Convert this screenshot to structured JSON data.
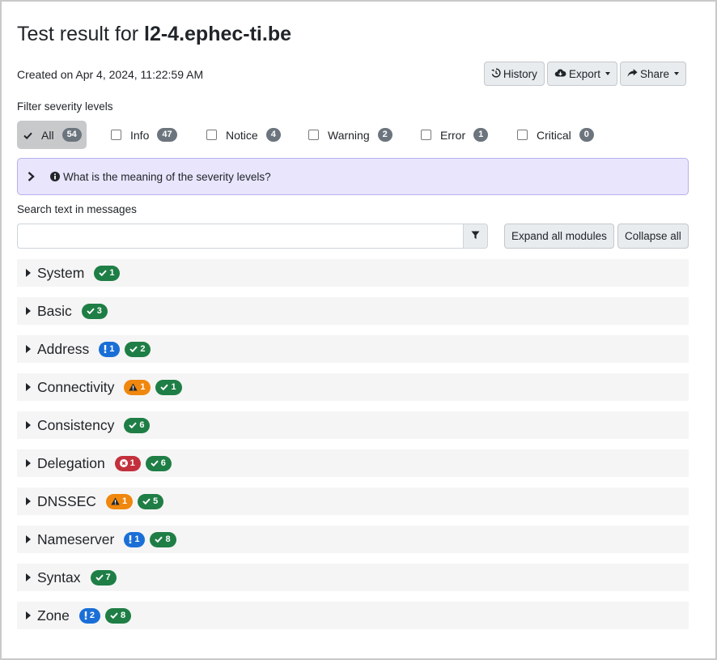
{
  "header": {
    "title_prefix": "Test result for ",
    "domain": "l2-4.ephec-ti.be",
    "created": "Created on Apr 4, 2024, 11:22:59 AM"
  },
  "toolbar": {
    "history_label": "History",
    "export_label": "Export",
    "share_label": "Share"
  },
  "filter": {
    "label": "Filter severity levels",
    "levels": [
      {
        "label": "All",
        "count": "54"
      },
      {
        "label": "Info",
        "count": "47"
      },
      {
        "label": "Notice",
        "count": "4"
      },
      {
        "label": "Warning",
        "count": "2"
      },
      {
        "label": "Error",
        "count": "1"
      },
      {
        "label": "Critical",
        "count": "0"
      }
    ]
  },
  "severity_help": {
    "label": "What is the meaning of the severity levels?"
  },
  "search": {
    "label": "Search text in messages",
    "value": "",
    "placeholder": "",
    "expand_label": "Expand all modules",
    "collapse_label": "Collapse all"
  },
  "colors": {
    "ok": "#1e7e45",
    "notice": "#1a6fd6",
    "warning": "#f0870e",
    "error": "#c3303c",
    "help_bg": "#e8e5fd"
  },
  "modules": [
    {
      "name": "System",
      "badges": [
        {
          "type": "ok",
          "count": "1"
        }
      ]
    },
    {
      "name": "Basic",
      "badges": [
        {
          "type": "ok",
          "count": "3"
        }
      ]
    },
    {
      "name": "Address",
      "badges": [
        {
          "type": "notice",
          "count": "1"
        },
        {
          "type": "ok",
          "count": "2"
        }
      ]
    },
    {
      "name": "Connectivity",
      "badges": [
        {
          "type": "warning",
          "count": "1"
        },
        {
          "type": "ok",
          "count": "1"
        }
      ]
    },
    {
      "name": "Consistency",
      "badges": [
        {
          "type": "ok",
          "count": "6"
        }
      ]
    },
    {
      "name": "Delegation",
      "badges": [
        {
          "type": "error",
          "count": "1"
        },
        {
          "type": "ok",
          "count": "6"
        }
      ]
    },
    {
      "name": "DNSSEC",
      "badges": [
        {
          "type": "warning",
          "count": "1"
        },
        {
          "type": "ok",
          "count": "5"
        }
      ]
    },
    {
      "name": "Nameserver",
      "badges": [
        {
          "type": "notice",
          "count": "1"
        },
        {
          "type": "ok",
          "count": "8"
        }
      ]
    },
    {
      "name": "Syntax",
      "badges": [
        {
          "type": "ok",
          "count": "7"
        }
      ]
    },
    {
      "name": "Zone",
      "badges": [
        {
          "type": "notice",
          "count": "2"
        },
        {
          "type": "ok",
          "count": "8"
        }
      ]
    }
  ]
}
